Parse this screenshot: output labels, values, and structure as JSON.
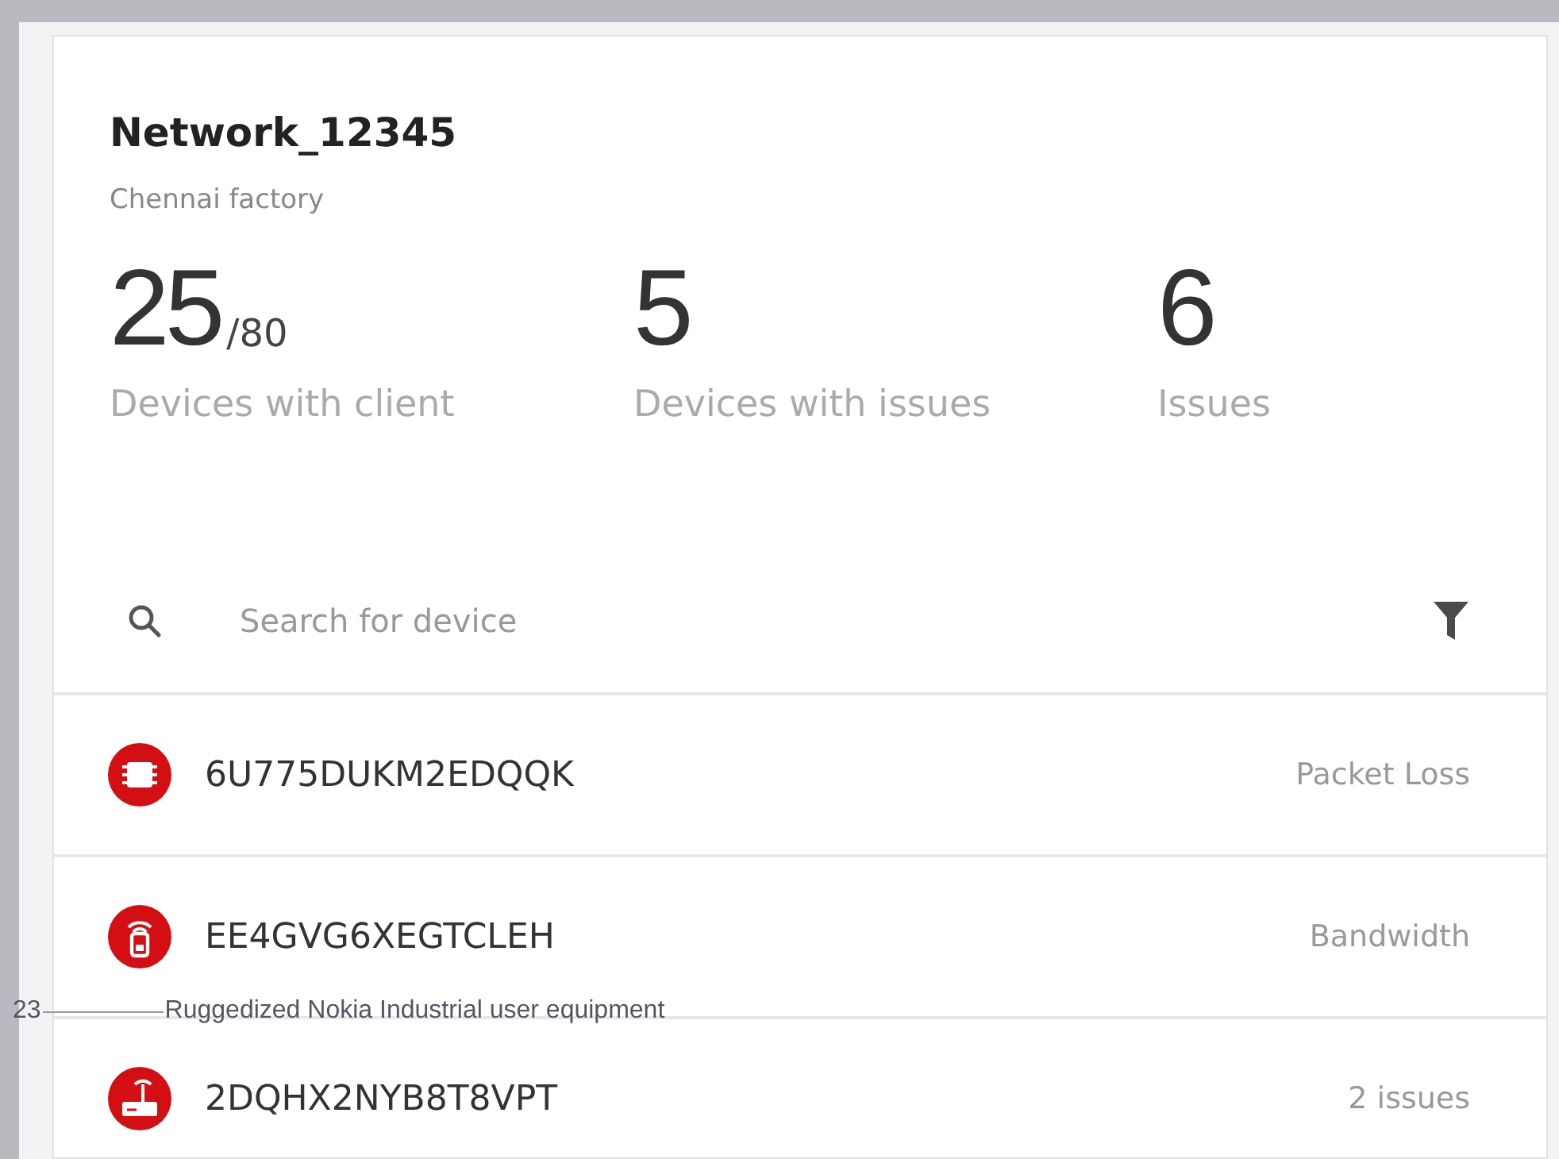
{
  "network": {
    "title": "Network_12345",
    "location": "Chennai factory"
  },
  "stats": [
    {
      "value": "25",
      "total": "/80",
      "label": "Devices with client"
    },
    {
      "value": "5",
      "label": "Devices with issues"
    },
    {
      "value": "6",
      "label": "Issues"
    }
  ],
  "search": {
    "placeholder": "Search for device"
  },
  "devices": [
    {
      "kind": "chip",
      "id": "6U775DUKM2EDQQK",
      "issue": "Packet Loss"
    },
    {
      "kind": "handheld",
      "id": "EE4GVG6XEGTCLEH",
      "issue": "Bandwidth"
    },
    {
      "kind": "router",
      "id": "2DQHX2NYB8T8VPT",
      "issue": "2 issues"
    }
  ],
  "footer": {
    "page": "23",
    "caption": "Ruggedized Nokia Industrial user equipment"
  }
}
